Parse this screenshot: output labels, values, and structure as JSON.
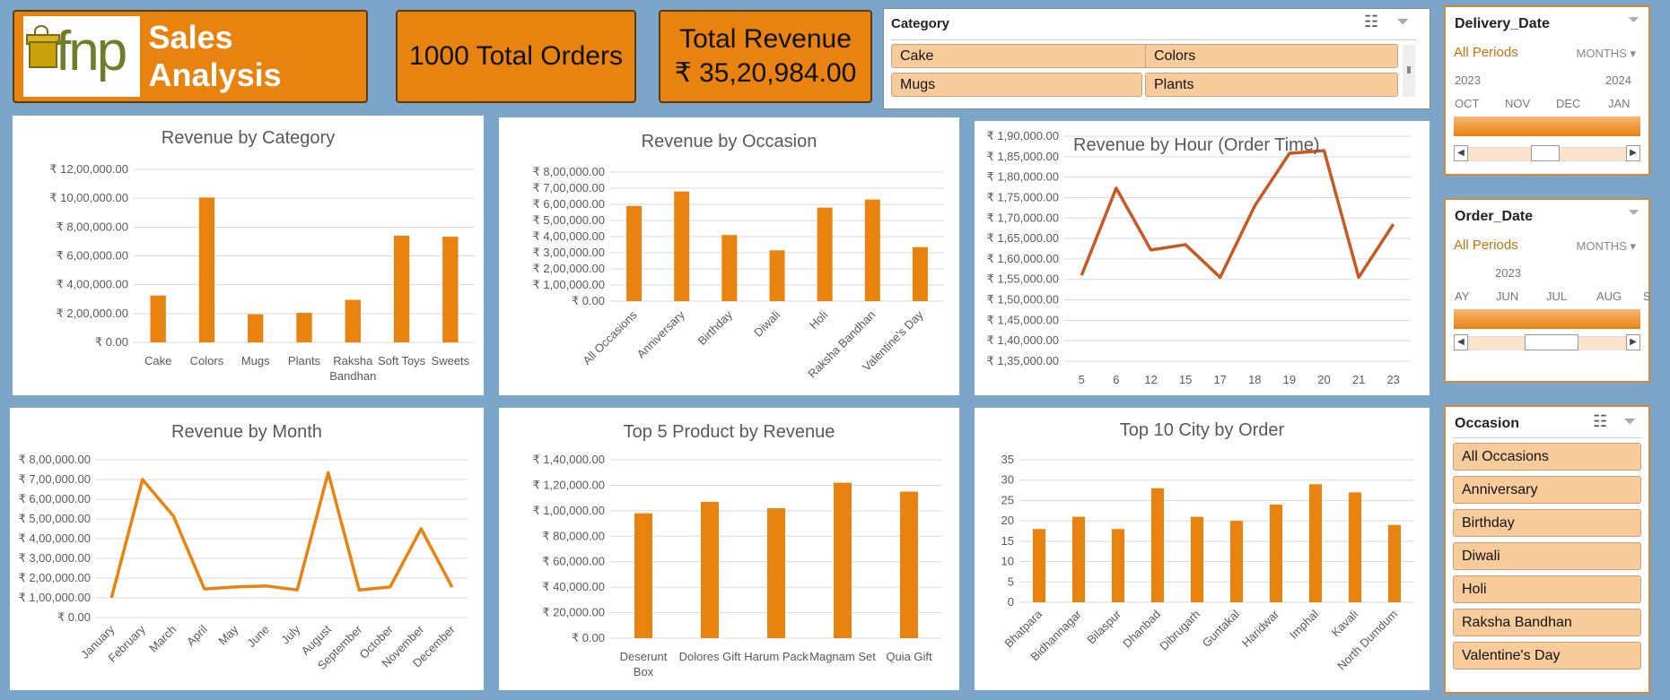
{
  "header": {
    "logo_text": "fnp",
    "title": "Sales Analysis",
    "total_orders": "1000 Total Orders",
    "revenue_label": "Total Revenue",
    "revenue_value": "₹ 35,20,984.00"
  },
  "colors": {
    "accent": "#e8830f",
    "line_dark": "#c55a22",
    "background": "#7ba6c9",
    "slicer_button": "#f8cc9a"
  },
  "category_slicer": {
    "title": "Category",
    "items": [
      "Cake",
      "Colors",
      "Mugs",
      "Plants"
    ]
  },
  "delivery_timeline": {
    "title": "Delivery_Date",
    "all_periods": "All Periods",
    "unit": "MONTHS",
    "years": [
      "2023",
      "2024"
    ],
    "months": [
      "OCT",
      "NOV",
      "DEC",
      "JAN"
    ]
  },
  "order_timeline": {
    "title": "Order_Date",
    "all_periods": "All Periods",
    "unit": "MONTHS",
    "years": [
      "2023"
    ],
    "months": [
      "AY",
      "JUN",
      "JUL",
      "AUG",
      "S"
    ]
  },
  "occasion_slicer": {
    "title": "Occasion",
    "items": [
      "All Occasions",
      "Anniversary",
      "Birthday",
      "Diwali",
      "Holi",
      "Raksha Bandhan",
      "Valentine's Day"
    ]
  },
  "chart_data": [
    {
      "id": "category",
      "type": "bar",
      "title": "Revenue by Category",
      "categories": [
        "Cake",
        "Colors",
        "Mugs",
        "Plants",
        "Raksha Bandhan",
        "Soft Toys",
        "Sweets"
      ],
      "values": [
        325000,
        1005000,
        195000,
        205000,
        295000,
        740000,
        733000
      ],
      "ylim": [
        0,
        1200000
      ],
      "yticks": [
        "₹ 0.00",
        "₹ 2,00,000.00",
        "₹ 4,00,000.00",
        "₹ 6,00,000.00",
        "₹ 8,00,000.00",
        "₹ 10,00,000.00",
        "₹ 12,00,000.00"
      ]
    },
    {
      "id": "occasion",
      "type": "bar",
      "title": "Revenue by Occasion",
      "categories": [
        "All Occasions",
        "Anniversary",
        "Birthday",
        "Diwali",
        "Holi",
        "Raksha Bandhan",
        "Valentine's Day"
      ],
      "values": [
        590000,
        680000,
        410000,
        315000,
        580000,
        630000,
        335000
      ],
      "ylim": [
        0,
        800000
      ],
      "yticks": [
        "₹ 0.00",
        "₹ 1,00,000.00",
        "₹ 2,00,000.00",
        "₹ 3,00,000.00",
        "₹ 4,00,000.00",
        "₹ 5,00,000.00",
        "₹ 6,00,000.00",
        "₹ 7,00,000.00",
        "₹ 8,00,000.00"
      ]
    },
    {
      "id": "hour",
      "type": "line",
      "title": "Revenue by Hour (Order Time)",
      "categories": [
        "5",
        "6",
        "12",
        "15",
        "17",
        "18",
        "19",
        "20",
        "21",
        "23"
      ],
      "values": [
        1560000,
        1773000,
        1622000,
        1635000,
        1555000,
        1730000,
        1858000,
        1865000,
        1555000,
        1685000
      ],
      "ylim": [
        1350000,
        1900000
      ],
      "yticks": [
        "₹ 1,35,000.00",
        "₹ 1,40,000.00",
        "₹ 1,45,000.00",
        "₹ 1,50,000.00",
        "₹ 1,55,000.00",
        "₹ 1,60,000.00",
        "₹ 1,65,000.00",
        "₹ 1,70,000.00",
        "₹ 1,75,000.00",
        "₹ 1,80,000.00",
        "₹ 1,85,000.00",
        "₹ 1,90,000.00"
      ]
    },
    {
      "id": "month",
      "type": "line",
      "title": "Revenue by Month",
      "categories": [
        "January",
        "February",
        "March",
        "April",
        "May",
        "June",
        "July",
        "August",
        "September",
        "October",
        "November",
        "December"
      ],
      "values": [
        100000,
        700000,
        515000,
        145000,
        155000,
        160000,
        140000,
        735000,
        140000,
        155000,
        450000,
        155000
      ],
      "ylim": [
        0,
        800000
      ],
      "yticks": [
        "₹ 0.00",
        "₹ 1,00,000.00",
        "₹ 2,00,000.00",
        "₹ 3,00,000.00",
        "₹ 4,00,000.00",
        "₹ 5,00,000.00",
        "₹ 6,00,000.00",
        "₹ 7,00,000.00",
        "₹ 8,00,000.00"
      ]
    },
    {
      "id": "product",
      "type": "bar",
      "title": "Top 5 Product by Revenue",
      "categories": [
        "Deserunt Box",
        "Dolores Gift",
        "Harum Pack",
        "Magnam Set",
        "Quia Gift"
      ],
      "values": [
        98000,
        107000,
        102000,
        122000,
        115000
      ],
      "ylim": [
        0,
        140000
      ],
      "yticks": [
        "₹ 0.00",
        "₹ 20,000.00",
        "₹ 40,000.00",
        "₹ 60,000.00",
        "₹ 80,000.00",
        "₹ 1,00,000.00",
        "₹ 1,20,000.00",
        "₹ 1,40,000.00"
      ]
    },
    {
      "id": "city",
      "type": "bar",
      "title": "Top 10 City by Order",
      "categories": [
        "Bhatpara",
        "Bidhannagar",
        "Bilaspur",
        "Dhanbad",
        "Dibrugarh",
        "Guntakal",
        "Haridwar",
        "Imphal",
        "Kavali",
        "North Dumdum"
      ],
      "values": [
        18,
        21,
        18,
        28,
        21,
        20,
        24,
        29,
        27,
        19
      ],
      "ylim": [
        0,
        35
      ],
      "yticks": [
        "0",
        "5",
        "10",
        "15",
        "20",
        "25",
        "30",
        "35"
      ]
    }
  ]
}
